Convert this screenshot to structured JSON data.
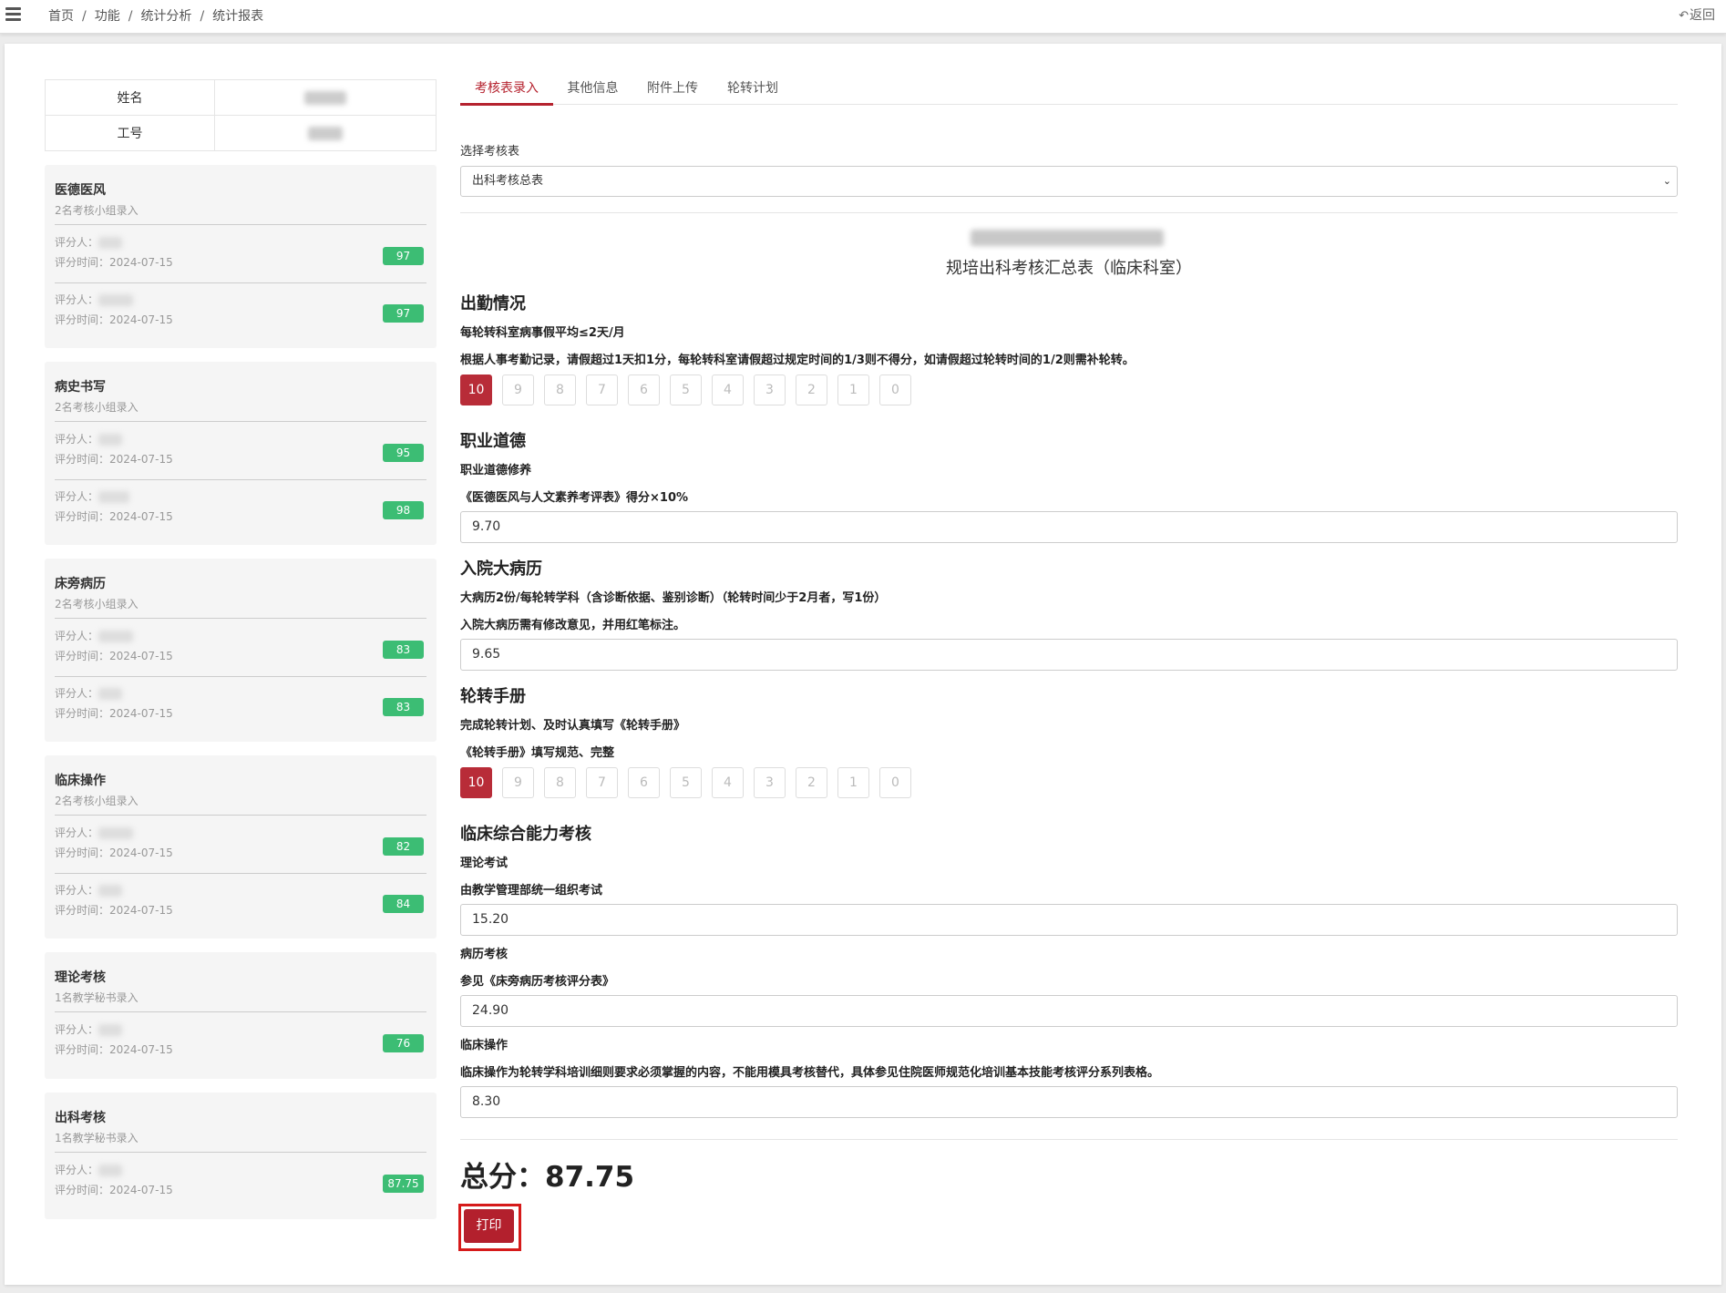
{
  "nav": {
    "menu_icon": "hamburger-menu-icon",
    "breadcrumb": [
      "首页",
      "功能",
      "统计分析",
      "统计报表"
    ],
    "separator": "/",
    "back_label": "返回"
  },
  "student": {
    "name_label": "姓名",
    "id_label": "工号"
  },
  "cards": [
    {
      "title": "医德医风",
      "subtitle": "2名考核小组录入",
      "entries": [
        {
          "rater_label": "评分人：",
          "time_label": "评分时间：2024-07-15",
          "score": "97"
        },
        {
          "rater_label": "评分人：",
          "time_label": "评分时间：2024-07-15",
          "score": "97"
        }
      ]
    },
    {
      "title": "病史书写",
      "subtitle": "2名考核小组录入",
      "entries": [
        {
          "rater_label": "评分人：",
          "time_label": "评分时间：2024-07-15",
          "score": "95"
        },
        {
          "rater_label": "评分人：",
          "time_label": "评分时间：2024-07-15",
          "score": "98"
        }
      ]
    },
    {
      "title": "床旁病历",
      "subtitle": "2名考核小组录入",
      "entries": [
        {
          "rater_label": "评分人：",
          "time_label": "评分时间：2024-07-15",
          "score": "83"
        },
        {
          "rater_label": "评分人：",
          "time_label": "评分时间：2024-07-15",
          "score": "83"
        }
      ]
    },
    {
      "title": "临床操作",
      "subtitle": "2名考核小组录入",
      "entries": [
        {
          "rater_label": "评分人：",
          "time_label": "评分时间：2024-07-15",
          "score": "82"
        },
        {
          "rater_label": "评分人：",
          "time_label": "评分时间：2024-07-15",
          "score": "84"
        }
      ]
    },
    {
      "title": "理论考核",
      "subtitle": "1名教学秘书录入",
      "entries": [
        {
          "rater_label": "评分人：",
          "time_label": "评分时间：2024-07-15",
          "score": "76"
        }
      ]
    },
    {
      "title": "出科考核",
      "subtitle": "1名教学秘书录入",
      "entries": [
        {
          "rater_label": "评分人：",
          "time_label": "评分时间：2024-07-15",
          "score": "87.75"
        }
      ]
    }
  ],
  "tabs": [
    "考核表录入",
    "其他信息",
    "附件上传",
    "轮转计划"
  ],
  "active_tab": "考核表录入",
  "form": {
    "select_label": "选择考核表",
    "select_value": "出科考核总表",
    "title": "规培出科考核汇总表（临床科室）",
    "score_options": [
      "10",
      "9",
      "8",
      "7",
      "6",
      "5",
      "4",
      "3",
      "2",
      "1",
      "0"
    ],
    "sections": {
      "attendance": {
        "heading": "出勤情况",
        "item": "每轮转科室病事假平均≤2天/月",
        "desc": "根据人事考勤记录，请假超过1天扣1分，每轮转科室请假超过规定时间的1/3则不得分，如请假超过轮转时间的1/2则需补轮转。",
        "selected": "10"
      },
      "ethics": {
        "heading": "职业道德",
        "item": "职业道德修养",
        "desc": "《医德医风与人文素养考评表》得分×10%",
        "value": "9.70"
      },
      "record": {
        "heading": "入院大病历",
        "item": "大病历2份/每轮转学科（含诊断依据、鉴别诊断）（轮转时间少于2月者，写1份）",
        "desc": "入院大病历需有修改意见，并用红笔标注。",
        "value": "9.65"
      },
      "handbook": {
        "heading": "轮转手册",
        "item": "完成轮转计划、及时认真填写《轮转手册》",
        "desc": "《轮转手册》填写规范、完整",
        "selected": "10"
      },
      "clinical": {
        "heading": "临床综合能力考核",
        "theory_item": "理论考试",
        "theory_desc": "由教学管理部统一组织考试",
        "theory_value": "15.20",
        "case_item": "病历考核",
        "case_desc": "参见《床旁病历考核评分表》",
        "case_value": "24.90",
        "op_item": "临床操作",
        "op_desc": "临床操作为轮转学科培训细则要求必须掌握的内容，不能用模具考核替代，具体参见住院医师规范化培训基本技能考核评分系列表格。",
        "op_value": "8.30"
      }
    },
    "total_label": "总分：87.75",
    "print_label": "打印"
  },
  "colors": {
    "accent": "#b5222e",
    "badge_green": "#3cbd74",
    "highlight_frame": "#d61a1a"
  }
}
